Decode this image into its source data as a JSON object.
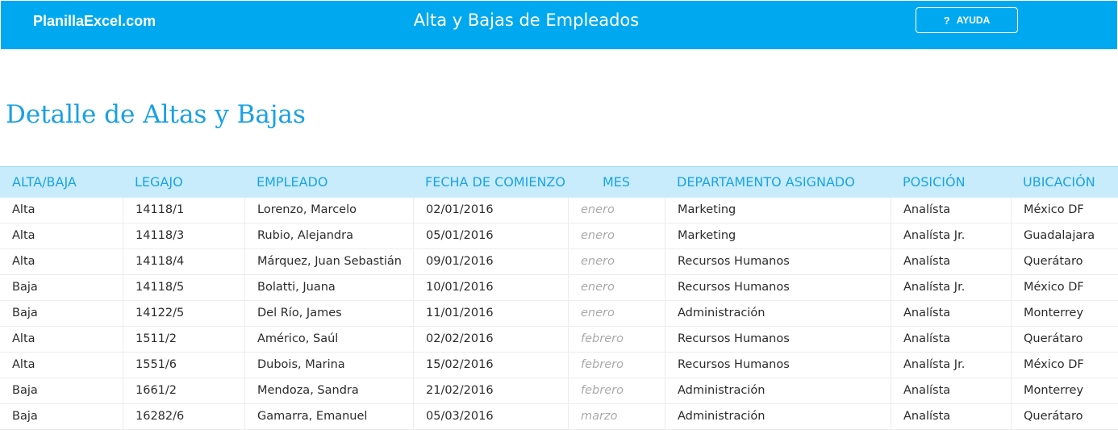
{
  "header": {
    "brand": "PlanillaExcel.com",
    "title": "Alta y Bajas de Empleados",
    "help_icon": "?",
    "help_label": "AYUDA"
  },
  "section_title": "Detalle de Altas y Bajas",
  "table": {
    "columns": [
      "ALTA/BAJA",
      "LEGAJO",
      "EMPLEADO",
      "FECHA DE COMIENZO",
      "MES",
      "DEPARTAMENTO ASIGNADO",
      "POSICIÓN",
      "UBICACIÓN"
    ],
    "rows": [
      [
        "Alta",
        "14118/1",
        "Lorenzo, Marcelo",
        "02/01/2016",
        "enero",
        "Marketing",
        "Analísta",
        "México DF"
      ],
      [
        "Alta",
        "14118/3",
        "Rubio, Alejandra",
        "05/01/2016",
        "enero",
        "Marketing",
        "Analísta Jr.",
        "Guadalajara"
      ],
      [
        "Alta",
        "14118/4",
        "Márquez, Juan Sebastián",
        "09/01/2016",
        "enero",
        "Recursos Humanos",
        "Analísta",
        "Querátaro"
      ],
      [
        "Baja",
        "14118/5",
        "Bolatti, Juana",
        "10/01/2016",
        "enero",
        "Recursos Humanos",
        "Analísta Jr.",
        "México DF"
      ],
      [
        "Baja",
        "14122/5",
        "Del Río, James",
        "11/01/2016",
        "enero",
        "Administración",
        "Analísta",
        "Monterrey"
      ],
      [
        "Alta",
        "1511/2",
        "Américo, Saúl",
        "02/02/2016",
        "febrero",
        "Recursos Humanos",
        "Analísta",
        "Querátaro"
      ],
      [
        "Alta",
        "1551/6",
        "Dubois, Marina",
        "15/02/2016",
        "febrero",
        "Recursos Humanos",
        "Analísta Jr.",
        "México DF"
      ],
      [
        "Baja",
        "1661/2",
        "Mendoza, Sandra",
        "21/02/2016",
        "febrero",
        "Administración",
        "Analísta",
        "Monterrey"
      ],
      [
        "Baja",
        "16282/6",
        "Gamarra, Emanuel",
        "05/03/2016",
        "marzo",
        "Administración",
        "Analísta",
        "Querátaro"
      ]
    ]
  },
  "colors": {
    "header_bg": "#00a9ef",
    "title_text": "#18a0e6",
    "table_header_bg": "#c8ecfc",
    "table_header_text": "#1ba3e6",
    "month_text": "#aaaaaa"
  }
}
